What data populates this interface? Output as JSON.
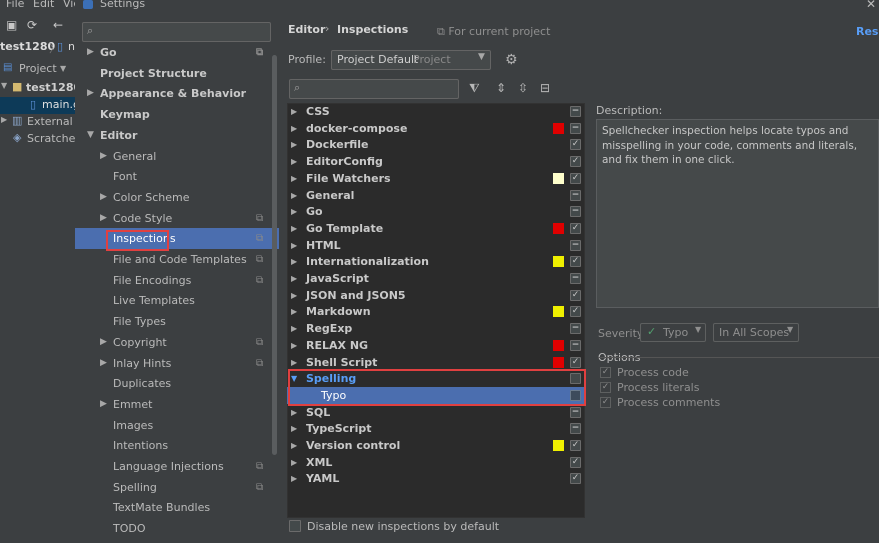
{
  "ide": {
    "menu": [
      "File",
      "Edit",
      "Vie"
    ],
    "project_name": "test1280",
    "crumb_file": "n",
    "project_dropdown": "Project",
    "tree": [
      {
        "label": "test1280",
        "bold": true
      },
      {
        "label": "main.g",
        "selected": true
      },
      {
        "label": "External L"
      },
      {
        "label": "Scratches"
      }
    ]
  },
  "dialog": {
    "title": "Settings",
    "close": "✕"
  },
  "left_tree": [
    {
      "label": "Go",
      "level": 0,
      "arrow": "▶",
      "bold": true,
      "copy": true
    },
    {
      "label": "Project Structure",
      "level": 0,
      "bold": true
    },
    {
      "label": "Appearance & Behavior",
      "level": 0,
      "arrow": "▶",
      "bold": true
    },
    {
      "label": "Keymap",
      "level": 0,
      "bold": true
    },
    {
      "label": "Editor",
      "level": 0,
      "arrow": "▼",
      "bold": true
    },
    {
      "label": "General",
      "level": 1,
      "arrow": "▶"
    },
    {
      "label": "Font",
      "level": 1
    },
    {
      "label": "Color Scheme",
      "level": 1,
      "arrow": "▶"
    },
    {
      "label": "Code Style",
      "level": 1,
      "arrow": "▶",
      "copy": true
    },
    {
      "label": "Inspections",
      "level": 1,
      "selected": true,
      "copy": true
    },
    {
      "label": "File and Code Templates",
      "level": 1,
      "copy": true
    },
    {
      "label": "File Encodings",
      "level": 1,
      "copy": true
    },
    {
      "label": "Live Templates",
      "level": 1
    },
    {
      "label": "File Types",
      "level": 1
    },
    {
      "label": "Copyright",
      "level": 1,
      "arrow": "▶",
      "copy": true
    },
    {
      "label": "Inlay Hints",
      "level": 1,
      "arrow": "▶",
      "copy": true
    },
    {
      "label": "Duplicates",
      "level": 1
    },
    {
      "label": "Emmet",
      "level": 1,
      "arrow": "▶"
    },
    {
      "label": "Images",
      "level": 1
    },
    {
      "label": "Intentions",
      "level": 1
    },
    {
      "label": "Language Injections",
      "level": 1,
      "copy": true
    },
    {
      "label": "Spelling",
      "level": 1,
      "copy": true
    },
    {
      "label": "TextMate Bundles",
      "level": 1
    },
    {
      "label": "TODO",
      "level": 1
    }
  ],
  "header": {
    "crumb_parent": "Editor",
    "crumb_sep": "›",
    "crumb_current": "Inspections",
    "for_current": "⧉ For current project",
    "reset": "Rese"
  },
  "profile": {
    "label": "Profile:",
    "value": "Project Default",
    "scope": "Project"
  },
  "inspections": [
    {
      "label": "CSS",
      "check": "−"
    },
    {
      "label": "docker-compose",
      "check": "−",
      "swatch": "#e00000"
    },
    {
      "label": "Dockerfile",
      "check": "✓"
    },
    {
      "label": "EditorConfig",
      "check": "✓"
    },
    {
      "label": "File Watchers",
      "check": "✓",
      "swatch": "#ffffcc"
    },
    {
      "label": "General",
      "check": "−"
    },
    {
      "label": "Go",
      "check": "−"
    },
    {
      "label": "Go Template",
      "check": "✓",
      "swatch": "#e00000"
    },
    {
      "label": "HTML",
      "check": "−"
    },
    {
      "label": "Internationalization",
      "check": "✓",
      "swatch": "#f0f000"
    },
    {
      "label": "JavaScript",
      "check": "−"
    },
    {
      "label": "JSON and JSON5",
      "check": "✓"
    },
    {
      "label": "Markdown",
      "check": "✓",
      "swatch": "#f0f000"
    },
    {
      "label": "RegExp",
      "check": "−"
    },
    {
      "label": "RELAX NG",
      "check": "−",
      "swatch": "#e00000"
    },
    {
      "label": "Shell Script",
      "check": "✓",
      "swatch": "#e00000"
    },
    {
      "label": "Spelling",
      "check": "",
      "expanded": true,
      "highlight": true
    },
    {
      "label": "Typo",
      "check": "",
      "child": true,
      "selected": true
    },
    {
      "label": "SQL",
      "check": "−"
    },
    {
      "label": "TypeScript",
      "check": "−"
    },
    {
      "label": "Version control",
      "check": "✓",
      "swatch": "#f0f000"
    },
    {
      "label": "XML",
      "check": "✓"
    },
    {
      "label": "YAML",
      "check": "✓"
    }
  ],
  "disable_new": "Disable new inspections by default",
  "description": {
    "label": "Description:",
    "text": "Spellchecker inspection helps locate typos and misspelling in your code, comments and literals, and fix them in one click."
  },
  "severity": {
    "label": "Severity:",
    "value": "Typo",
    "scope": "In All Scopes"
  },
  "options": {
    "label": "Options",
    "items": [
      "Process code",
      "Process literals",
      "Process comments"
    ]
  }
}
